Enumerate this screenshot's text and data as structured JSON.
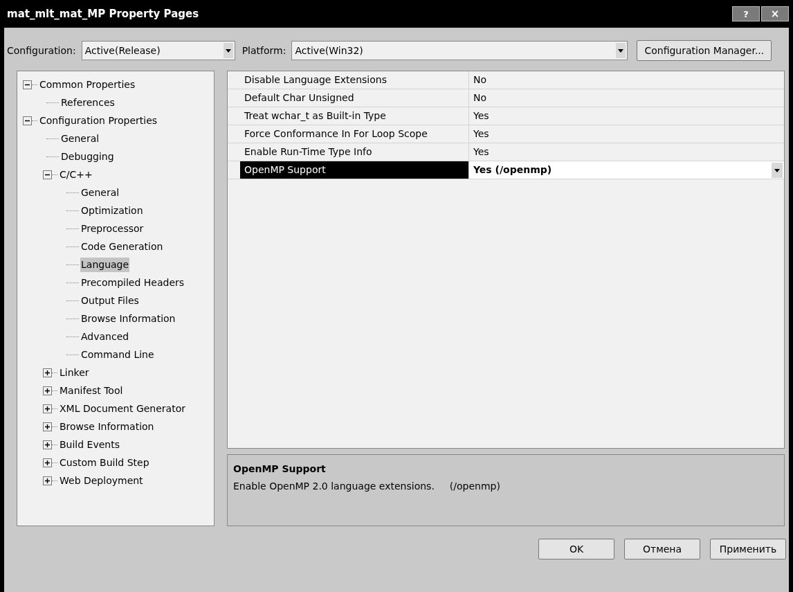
{
  "window": {
    "title": "mat_mlt_mat_MP Property Pages",
    "help_button": "?",
    "close_button": "×"
  },
  "configuration": {
    "label": "Configuration:",
    "value": "Active(Release)"
  },
  "platform": {
    "label": "Platform:",
    "value": "Active(Win32)"
  },
  "configuration_manager_button": "Configuration Manager...",
  "tree": [
    {
      "label": "Common Properties",
      "expanded": true,
      "selected": false,
      "children": [
        {
          "label": "References",
          "selected": false
        }
      ]
    },
    {
      "label": "Configuration Properties",
      "expanded": true,
      "selected": false,
      "children": [
        {
          "label": "General",
          "selected": false
        },
        {
          "label": "Debugging",
          "selected": false
        },
        {
          "label": "C/C++",
          "expanded": true,
          "selected": false,
          "children": [
            {
              "label": "General",
              "selected": false
            },
            {
              "label": "Optimization",
              "selected": false
            },
            {
              "label": "Preprocessor",
              "selected": false
            },
            {
              "label": "Code Generation",
              "selected": false
            },
            {
              "label": "Language",
              "selected": true
            },
            {
              "label": "Precompiled Headers",
              "selected": false
            },
            {
              "label": "Output Files",
              "selected": false
            },
            {
              "label": "Browse Information",
              "selected": false
            },
            {
              "label": "Advanced",
              "selected": false
            },
            {
              "label": "Command Line",
              "selected": false
            }
          ]
        },
        {
          "label": "Linker",
          "expanded": false,
          "selected": false
        },
        {
          "label": "Manifest Tool",
          "expanded": false,
          "selected": false
        },
        {
          "label": "XML Document Generator",
          "expanded": false,
          "selected": false
        },
        {
          "label": "Browse Information",
          "expanded": false,
          "selected": false
        },
        {
          "label": "Build Events",
          "expanded": false,
          "selected": false
        },
        {
          "label": "Custom Build Step",
          "expanded": false,
          "selected": false
        },
        {
          "label": "Web Deployment",
          "expanded": false,
          "selected": false
        }
      ]
    }
  ],
  "properties": [
    {
      "name": "Disable Language Extensions",
      "value": "No",
      "selected": false
    },
    {
      "name": "Default Char Unsigned",
      "value": "No",
      "selected": false
    },
    {
      "name": "Treat wchar_t as Built-in Type",
      "value": "Yes",
      "selected": false
    },
    {
      "name": "Force Conformance In For Loop Scope",
      "value": "Yes",
      "selected": false
    },
    {
      "name": "Enable Run-Time Type Info",
      "value": "Yes",
      "selected": false
    },
    {
      "name": "OpenMP Support",
      "value": "Yes (/openmp)",
      "selected": true
    }
  ],
  "description": {
    "title": "OpenMP Support",
    "text": "Enable OpenMP 2.0 language extensions.",
    "compiler_flag": "(/openmp)"
  },
  "buttons": [
    "OK",
    "Отмена",
    "Применить"
  ]
}
